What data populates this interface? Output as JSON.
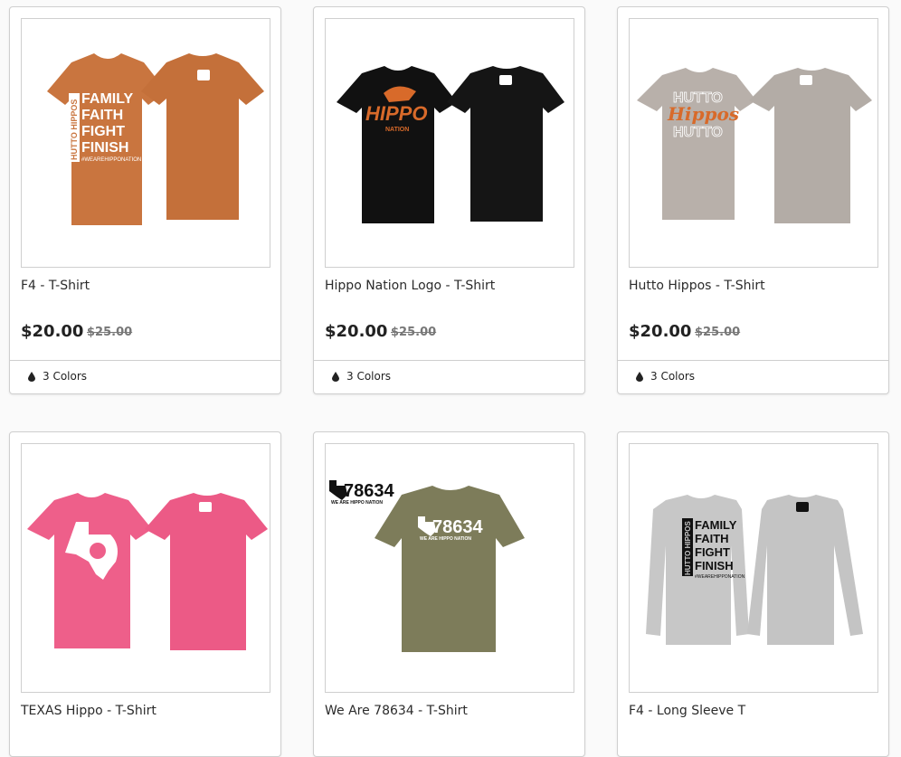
{
  "products": [
    {
      "title": "F4 - T-Shirt",
      "price": "$20.00",
      "compare_price": "$25.00",
      "colors": "3 Colors",
      "color": "#c9753f",
      "style": "tee-pair"
    },
    {
      "title": "Hippo Nation Logo - T-Shirt",
      "price": "$20.00",
      "compare_price": "$25.00",
      "colors": "3 Colors",
      "color": "#111111",
      "style": "tee-pair"
    },
    {
      "title": "Hutto Hippos - T-Shirt",
      "price": "$20.00",
      "compare_price": "$25.00",
      "colors": "3 Colors",
      "color": "#b8b0aa",
      "style": "tee-pair"
    },
    {
      "title": "TEXAS Hippo - T-Shirt",
      "color": "#ee5f8a",
      "style": "tee-pair"
    },
    {
      "title": "We Are 78634 - T-Shirt",
      "color": "#7d7c5a",
      "style": "tee-single"
    },
    {
      "title": "F4 - Long Sleeve T",
      "color": "#c7c7c7",
      "style": "longsleeve-pair"
    }
  ],
  "icons": {
    "colors": "droplet-icon"
  },
  "print": {
    "f4_side": "HUTTO HIPPOS",
    "f4_lines": [
      "FAMILY",
      "FAITH",
      "FIGHT",
      "FINISH"
    ],
    "f4_tag": "#WEAREHIPPONATION",
    "hippo": "HIPPO",
    "nation": "NATION",
    "hippos_script": "Hippos",
    "hutto_outline": "HUTTO",
    "zip": "78634",
    "zip_tag": "WE ARE HIPPO NATION"
  }
}
